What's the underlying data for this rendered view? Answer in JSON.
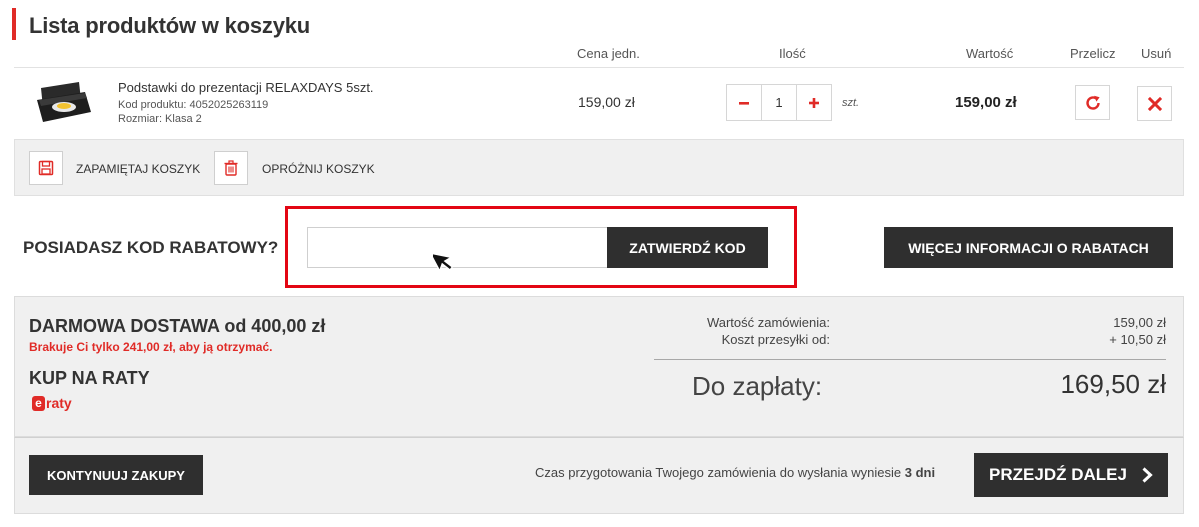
{
  "cart": {
    "title": "Lista produktów w koszyku",
    "columns": {
      "unit_price": "Cena jedn.",
      "quantity": "Ilość",
      "value": "Wartość",
      "recalc": "Przelicz",
      "remove": "Usuń"
    },
    "item": {
      "name": "Podstawki do prezentacji RELAXDAYS 5szt.",
      "code": "Kod produktu: 4052025263119",
      "size": "Rozmiar: Klasa 2",
      "unit_price": "159,00 zł",
      "quantity": "1",
      "unit": "szt.",
      "value": "159,00 zł"
    },
    "actions": {
      "save": "ZAPAMIĘTAJ KOSZYK",
      "clear": "OPRÓŻNIJ KOSZYK"
    }
  },
  "discount": {
    "label": "POSIADASZ KOD RABATOWY?",
    "input_value": "",
    "input_placeholder": "",
    "submit": "ZATWIERDŹ KOD",
    "more_info": "WIĘCEJ INFORMACJI O RABATACH"
  },
  "summary": {
    "free_shipping": "DARMOWA DOSTAWA od 400,00 zł",
    "missing": "Brakuje Ci tylko 241,00 zł, aby ją otrzymać.",
    "installments": "KUP NA RATY",
    "eraty_logo": "raty",
    "order_value_label": "Wartość zamówienia:",
    "order_value": "159,00 zł",
    "shipping_label": "Koszt przesyłki od:",
    "shipping_value": "+ 10,50 zł",
    "total_label": "Do zapłaty:",
    "total_value": "169,50 zł"
  },
  "footer": {
    "continue": "KONTYNUUJ ZAKUPY",
    "prep_text": "Czas przygotowania Twojego zamówienia do wysłania wyniesie",
    "prep_days": "3 dni",
    "next": "PRZEJDŹ DALEJ"
  },
  "colors": {
    "accent": "#e02b27",
    "dark_button": "#2f2f2f",
    "panel": "#f0f0f0",
    "highlight_frame": "#e30613"
  }
}
